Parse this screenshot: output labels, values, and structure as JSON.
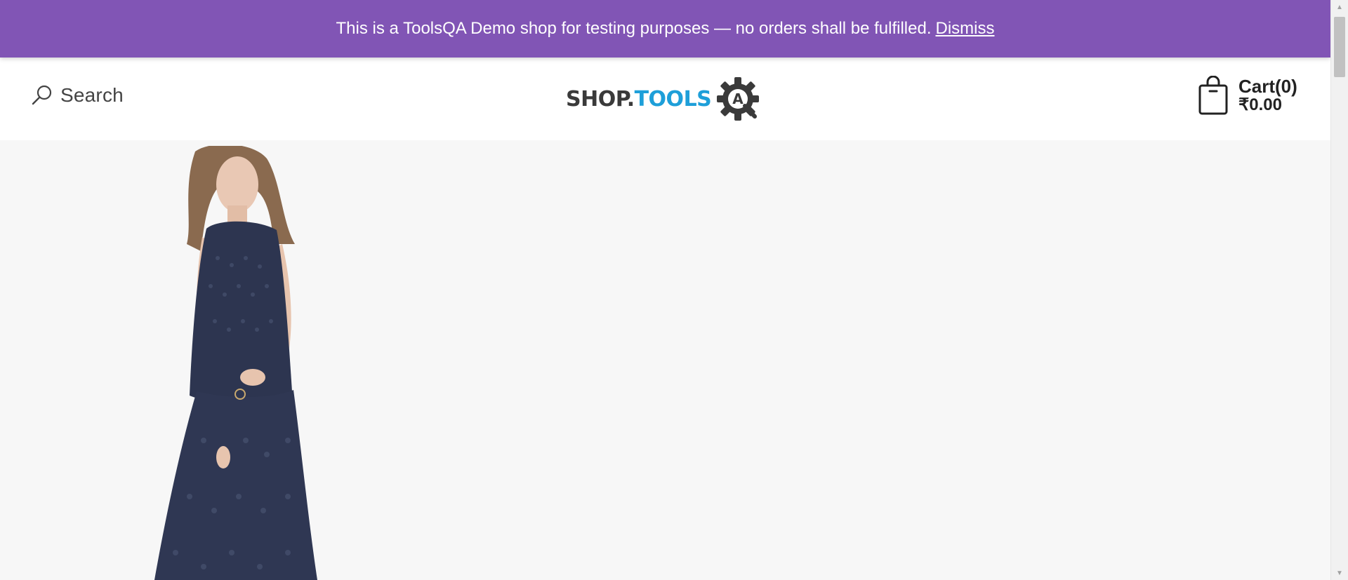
{
  "notice": {
    "message": "This is a ToolsQA Demo shop for testing purposes — no orders shall be fulfilled.",
    "dismiss_label": "Dismiss",
    "background_color": "#8155b5"
  },
  "header": {
    "search": {
      "icon": "search-icon",
      "label": "Search"
    },
    "logo": {
      "part1": "SHOP.",
      "part2": "TOOLS",
      "emblem_letter": "A",
      "emblem_icon": "gear-icon",
      "accent_color": "#1e9fd9"
    },
    "cart": {
      "icon": "shopping-bag-icon",
      "count_label": "Cart(0)",
      "total_label": "₹0.00"
    }
  },
  "hero": {
    "image": "product-image-woman-navy-dress"
  }
}
